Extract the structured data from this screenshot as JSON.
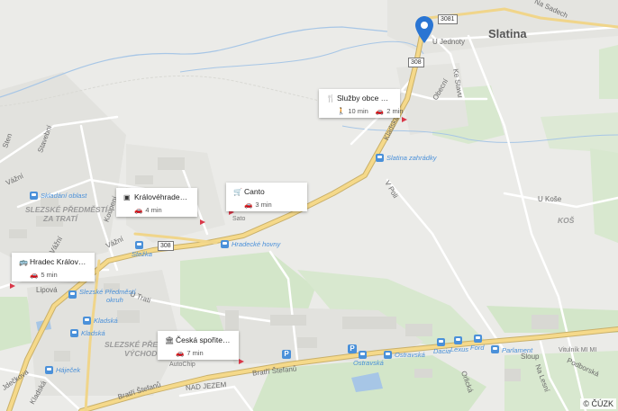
{
  "map": {
    "colors": {
      "background": "#ebebe8",
      "green": "#d3e6c9",
      "water": "#a7c6e6",
      "main_road": "#f5d98a",
      "minor_road": "#ffffff",
      "transit_blue": "#4a90d9",
      "pin_blue": "#2a75d3"
    },
    "towns": {
      "slatina": "Slatina"
    },
    "districts": {
      "slezske_predmesti_za_trati_1": "SLEZSKÉ PŘEDMĚSTÍ-",
      "slezske_predmesti_za_trati_2": "ZA TRATÍ",
      "slezske_predmesti_vychod_1": "SLEZSKÉ PŘEDM",
      "slezske_predmesti_vychod_2": "VÝCHOD",
      "kos": "KOŠ"
    },
    "streets": {
      "u_jednoty": "U Jednoty",
      "na_sadech": "Na Sadech",
      "ke_stavu": "Ke Stavu",
      "obecni": "Obecní",
      "kladska_n": "Kladská",
      "v_poli": "V Poli",
      "u_kose": "U Koše",
      "stavebni": "Stavební",
      "vazni_1": "Vážní",
      "vazni_2": "Vážní",
      "vazni_3": "Vážní",
      "koupeni": "Koupení",
      "lipova": "Lipová",
      "u_trati": "U Trati",
      "nad_jezem": "NAD JEZEM",
      "bratri_stefanu_1": "Bratří Štefanů",
      "bratri_stefanu_2": "Bratří Štefanů",
      "orlicka": "Orlická",
      "na_lesni": "Na Lesní",
      "podborska": "Podborská",
      "sloup": "Sloup",
      "jdeckova": "Jdečkova",
      "kladska_s": "Kladská",
      "stenice": "Sten"
    },
    "transit_stops": {
      "slatina_zahradky": "Slatina zahrádky",
      "skladacni_oblast": "Skladání oblast",
      "hradecke_hovny": "Hradecké hovny",
      "stezka": "Stežka",
      "slezske_predmesti_okruh_1": "Slezské Předměstí",
      "slezske_predmesti_okruh_2": "okruh",
      "kladska_1": "Kladská",
      "kladska_2": "Kladská",
      "hajecek": "Háječek",
      "ostravska_1": "Ostravská",
      "ostravska_2": "Ostravská",
      "dacia": "Dacia",
      "lexus": "Lexus",
      "ford": "Ford",
      "parlament": "Parlament"
    },
    "pois": {
      "sato": "Sato",
      "autochip": "AutoChip",
      "vitulnik": "Vitulník MI MI"
    },
    "road_numbers": {
      "r3081": "3081",
      "r308a": "308",
      "r308b": "308"
    },
    "parking_label": "P",
    "attribution": "© ČÚZK"
  },
  "places": [
    {
      "title": "Služby obce Holo...",
      "icon": "restaurant-icon",
      "walk": "10 min",
      "drive": "2 min"
    },
    {
      "title": "Canto",
      "icon": "shop-icon",
      "walk": "",
      "drive": "3 min"
    },
    {
      "title": "Královéhradecká ...",
      "icon": "building-icon",
      "walk": "",
      "drive": "4 min"
    },
    {
      "title": "Hradec Králové-Sl...",
      "icon": "bus-icon",
      "walk": "",
      "drive": "5 min"
    },
    {
      "title": "Česká spořitelna",
      "icon": "bank-icon",
      "walk": "",
      "drive": "7 min"
    }
  ]
}
